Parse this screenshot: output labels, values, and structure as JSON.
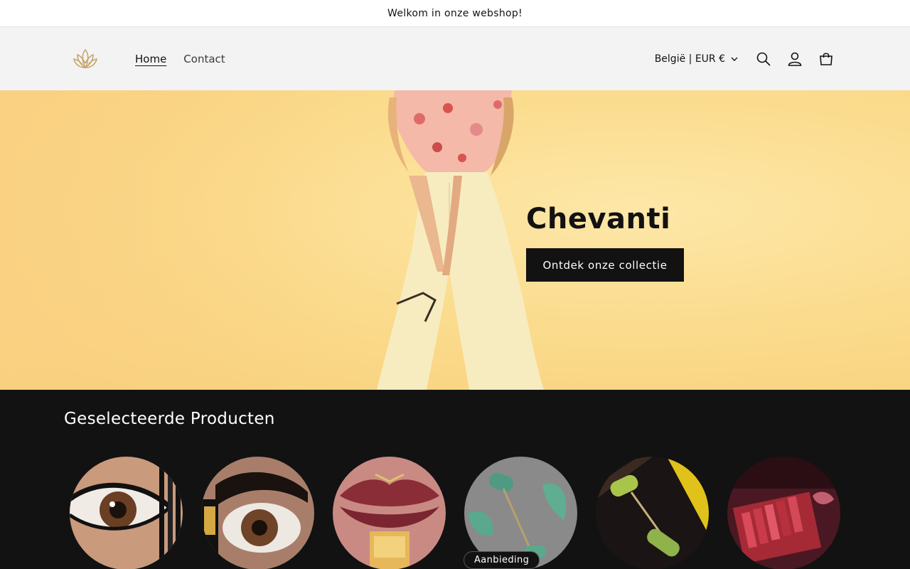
{
  "announcement": {
    "text": "Welkom in onze webshop!"
  },
  "header": {
    "logo_icon": "lotus-logo-icon",
    "nav": [
      {
        "label": "Home",
        "active": true
      },
      {
        "label": "Contact",
        "active": false
      }
    ],
    "country_selector": "België | EUR €",
    "icons": [
      "search-icon",
      "account-icon",
      "cart-icon"
    ]
  },
  "hero": {
    "title": "Chevanti",
    "button_label": "Ontdek onze collectie"
  },
  "featured": {
    "title": "Geselecteerde Producten",
    "products": [
      {
        "image": "eyeliner-eye",
        "badge": ""
      },
      {
        "image": "mascara-lashes",
        "badge": ""
      },
      {
        "image": "lipstick-lips",
        "badge": ""
      },
      {
        "image": "jade-roller",
        "badge": "Aanbieding"
      },
      {
        "image": "jade-roller-gold",
        "badge": ""
      },
      {
        "image": "lipstick-set",
        "badge": ""
      }
    ],
    "badge_label": "Aanbieding"
  },
  "colors": {
    "accent": "#121212",
    "hero_bg": "#fbdc8e",
    "header_bg": "#f3f3f3"
  }
}
